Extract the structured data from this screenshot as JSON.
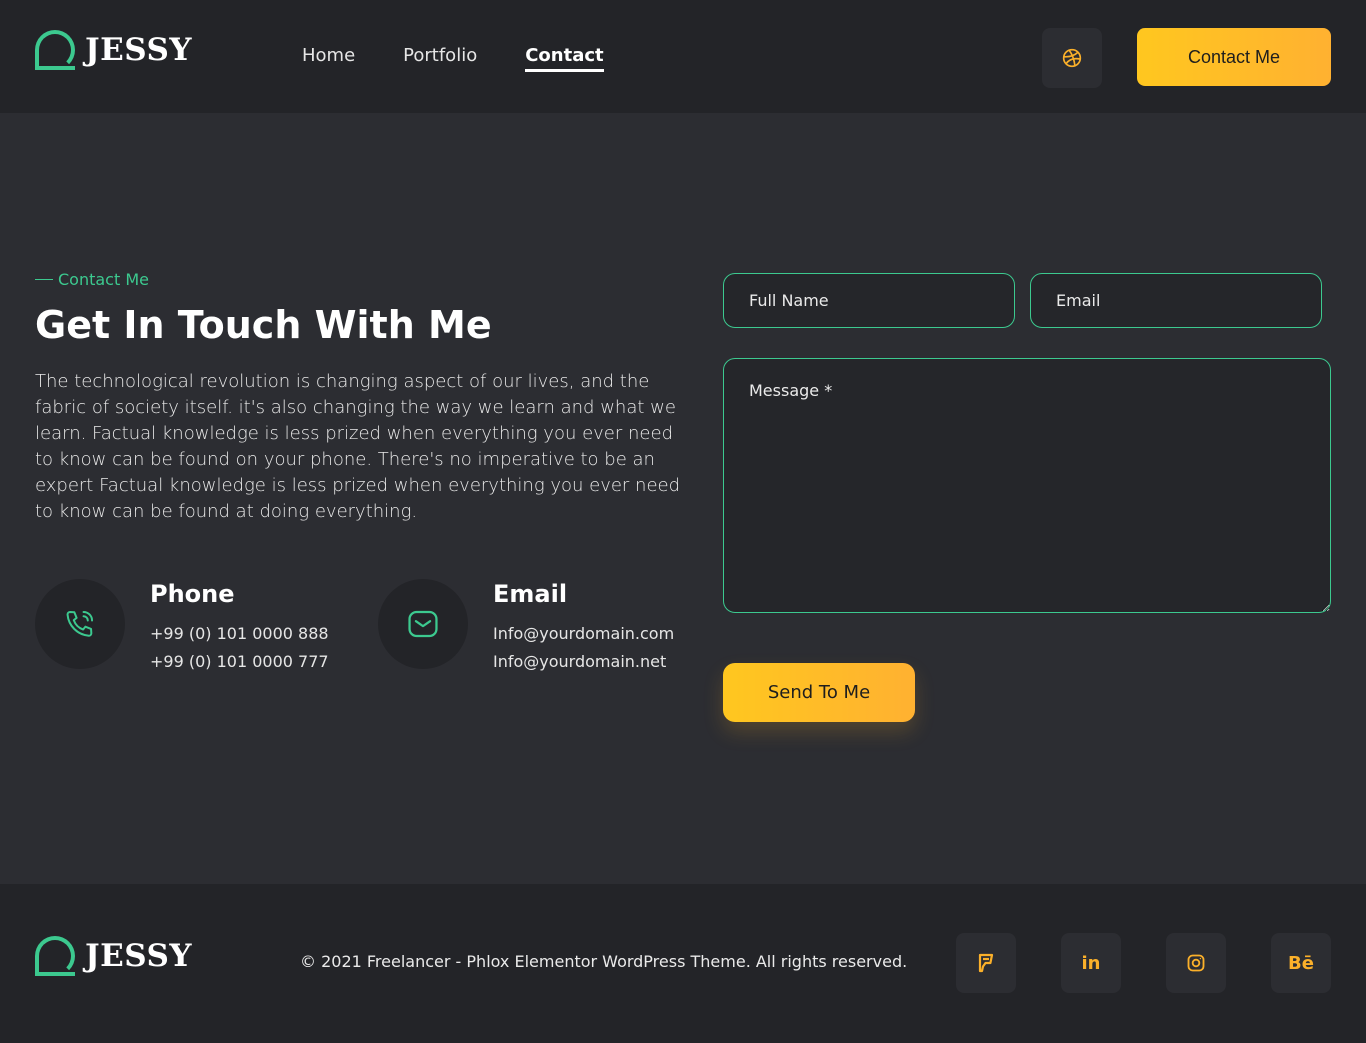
{
  "brand": {
    "name": "JESSY",
    "accent": "#3cc98f",
    "highlight": "#fbb02a"
  },
  "header": {
    "nav": [
      {
        "label": "Home"
      },
      {
        "label": "Portfolio"
      },
      {
        "label": "Contact",
        "active": true
      }
    ],
    "social_icon": "dribbble-icon",
    "cta_label": "Contact Me"
  },
  "section": {
    "eyebrow": "Contact Me",
    "title": "Get In Touch With Me",
    "description": "The technological revolution is changing aspect of our lives, and the fabric of society itself. it's also changing the way we learn and what we learn. Factual knowledge is less prized when everything you ever need to know can be found on your phone. There's no imperative to be an expert Factual knowledge is less prized when everything you ever need to know can be found at doing everything."
  },
  "contacts": [
    {
      "icon": "phone-icon",
      "title": "Phone",
      "lines": [
        "+99 (0) 101 0000 888",
        "+99 (0) 101 0000 777"
      ]
    },
    {
      "icon": "mail-icon",
      "title": "Email",
      "lines": [
        "Info@yourdomain.com",
        "Info@yourdomain.net"
      ]
    }
  ],
  "form": {
    "full_name_placeholder": "Full Name",
    "email_placeholder": "Email",
    "message_placeholder": "Message *",
    "submit_label": "Send To Me"
  },
  "footer": {
    "copyright": "© 2021 Freelancer - Phlox Elementor WordPress Theme. All rights reserved.",
    "social": [
      {
        "icon": "foursquare-icon"
      },
      {
        "icon": "linkedin-icon",
        "text": "in"
      },
      {
        "icon": "instagram-icon"
      },
      {
        "icon": "behance-icon",
        "text": "Bē"
      }
    ]
  }
}
